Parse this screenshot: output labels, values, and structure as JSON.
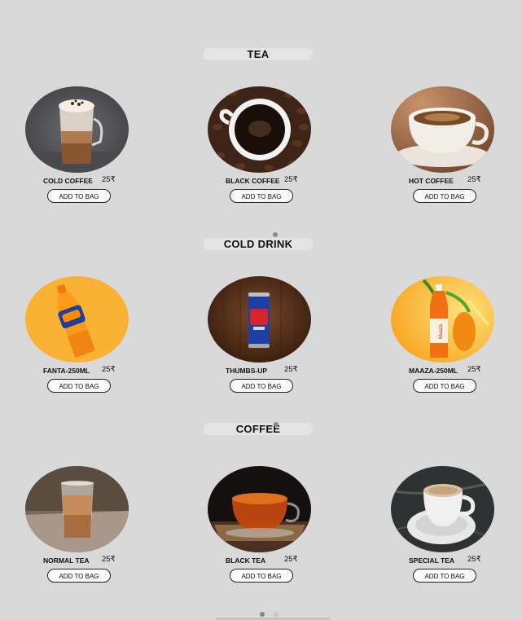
{
  "sections": [
    {
      "title": "TEA",
      "items": [
        {
          "name": "COLD COFFEE",
          "price": "25₹",
          "button": "ADD TO BAG",
          "image": "cold-coffee-image"
        },
        {
          "name": "BLACK COFFEE",
          "price": "25₹",
          "button": "ADD TO BAG",
          "image": "black-coffee-image"
        },
        {
          "name": "HOT COFFEE",
          "price": "25₹",
          "button": "ADD TO BAG",
          "image": "hot-coffee-image"
        }
      ]
    },
    {
      "title": "COLD DRINK",
      "items": [
        {
          "name": "FANTA-250ML",
          "price": "25₹",
          "button": "ADD TO BAG",
          "image": "fanta-bottle-image"
        },
        {
          "name": "THUMBS-UP",
          "price": "25₹",
          "button": "ADD TO BAG",
          "image": "thums-up-can-image"
        },
        {
          "name": "MAAZA-250ML",
          "price": "25₹",
          "button": "ADD TO BAG",
          "image": "maaza-bottle-image"
        }
      ]
    },
    {
      "title": "COFFEE",
      "items": [
        {
          "name": "NORMAL TEA",
          "price": "25₹",
          "button": "ADD TO BAG",
          "image": "normal-tea-image"
        },
        {
          "name": "BLACK TEA",
          "price": "25₹",
          "button": "ADD TO BAG",
          "image": "black-tea-image"
        },
        {
          "name": "SPECIAL TEA",
          "price": "25₹",
          "button": "ADD TO BAG",
          "image": "special-tea-image"
        }
      ]
    }
  ],
  "colors": {
    "background": "#d9d9d9",
    "title_bar": "#e4e4e4",
    "button_border": "#222222",
    "indicator_dot": "#7c8c8c"
  }
}
